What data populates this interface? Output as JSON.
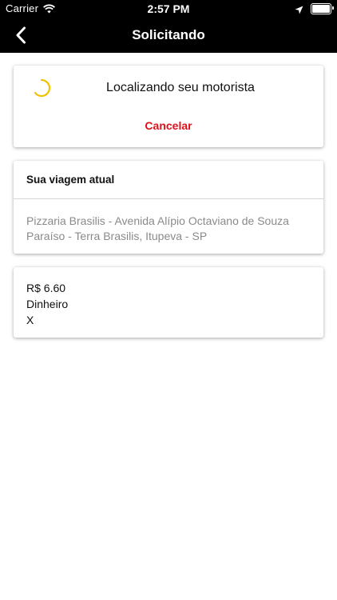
{
  "status_bar": {
    "carrier": "Carrier",
    "time": "2:57 PM",
    "battery_level": 1.0
  },
  "nav": {
    "title": "Solicitando",
    "back_icon": "chevron-left-icon"
  },
  "searching_card": {
    "message": "Localizando seu motorista",
    "cancel_label": "Cancelar",
    "spinner_color": "#f2c200",
    "cancel_color": "#e0101a"
  },
  "trip_card": {
    "heading": "Sua viagem atual",
    "address_line_1": "Pizzaria Brasilis - Avenida Alípio Octaviano de Souza",
    "address_line_2": "Paraíso - Terra Brasilis, Itupeva - SP"
  },
  "payment_card": {
    "price": "R$ 6.60",
    "method": "Dinheiro",
    "extra": "X"
  }
}
